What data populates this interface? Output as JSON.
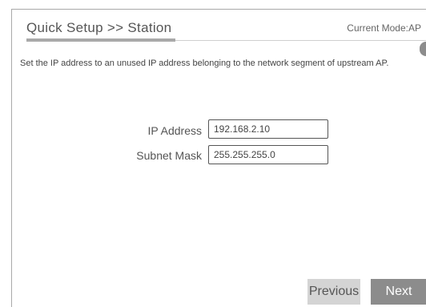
{
  "header": {
    "title": "Quick Setup >> Station",
    "current_mode": "Current Mode:AP"
  },
  "instruction": "Set the IP address to an unused IP address belonging to the network segment of upstream AP.",
  "fields": {
    "ip_address": {
      "label": "IP Address",
      "value": "192.168.2.10"
    },
    "subnet_mask": {
      "label": "Subnet Mask",
      "value": "255.255.255.0"
    }
  },
  "buttons": {
    "previous": "Previous",
    "next": "Next"
  },
  "colors": {
    "accent_bar": "#a9a9a9",
    "next_button": "#8c8c8c",
    "previous_button": "#d4d4d4"
  }
}
